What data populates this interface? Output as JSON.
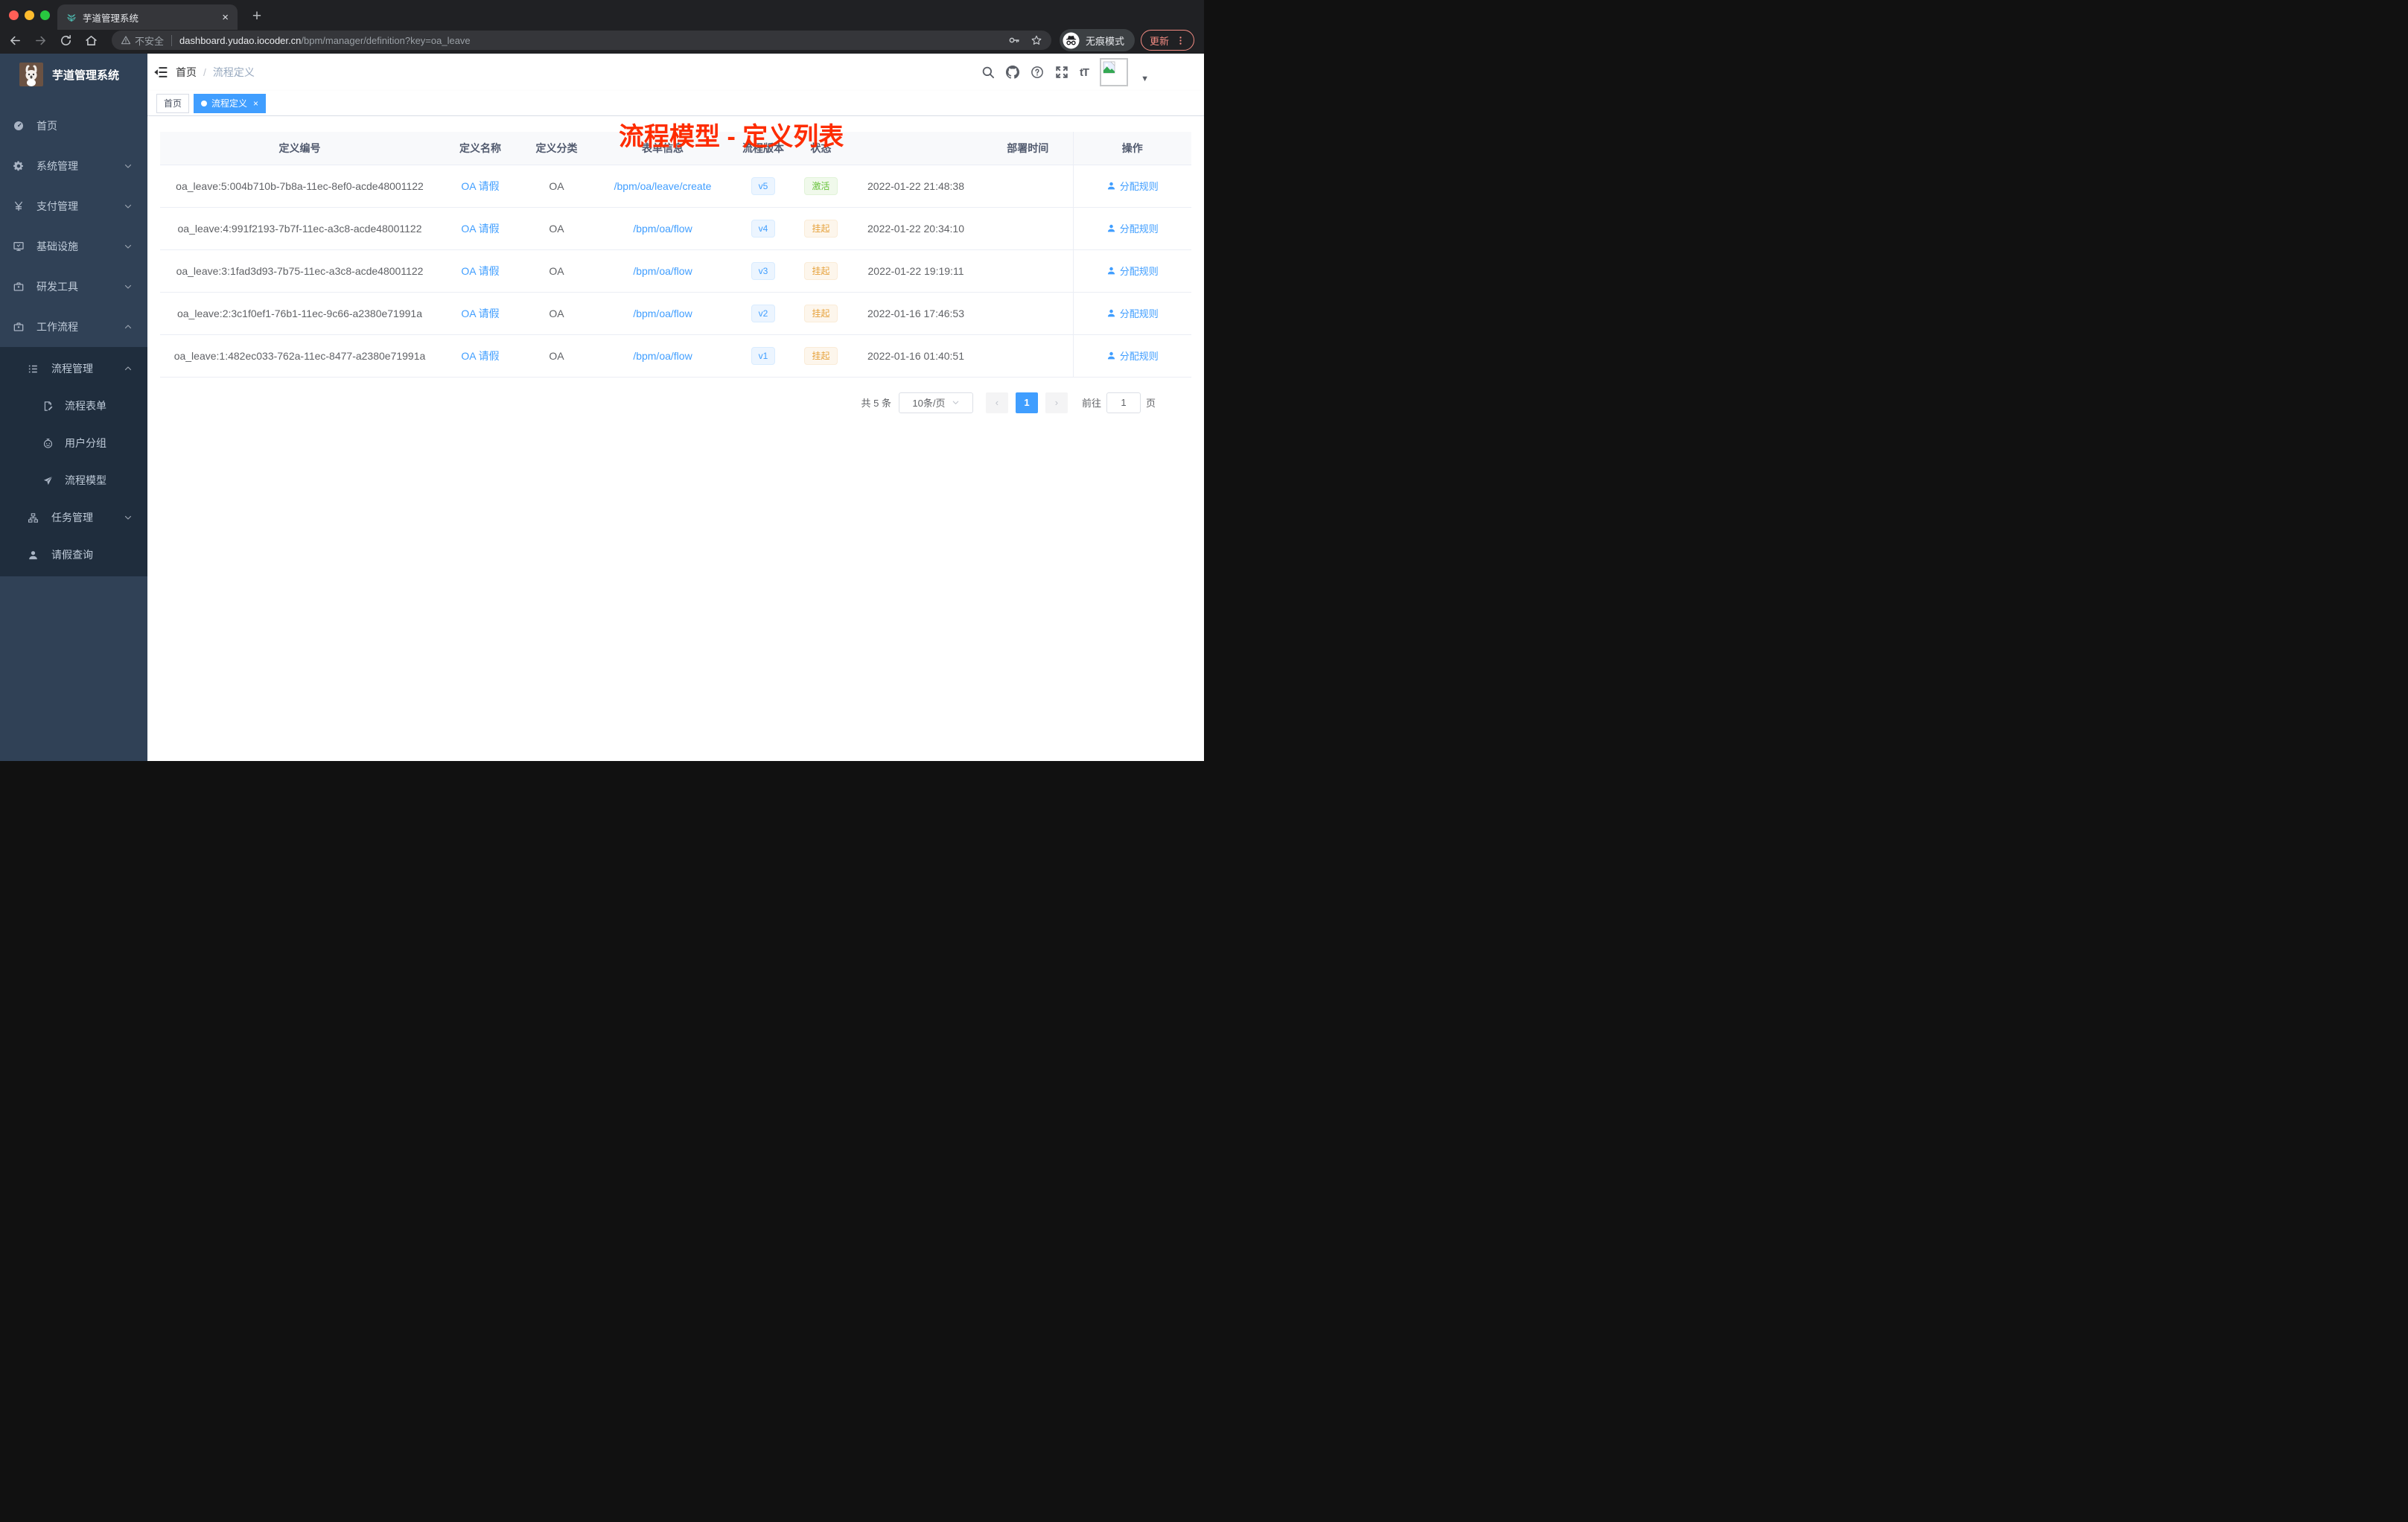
{
  "browser": {
    "tab": {
      "title": "芋道管理系统",
      "close": "×",
      "new_tab": "+"
    },
    "nav": {
      "security_label": "不安全",
      "url_host": "dashboard.yudao.iocoder.cn",
      "url_path": "/bpm/manager/definition?key=oa_leave",
      "incognito_label": "无痕模式",
      "update_label": "更新"
    }
  },
  "sidebar": {
    "app_title": "芋道管理系统",
    "menu": [
      {
        "label": "首页",
        "icon": "dashboard",
        "depth": 0
      },
      {
        "label": "系统管理",
        "icon": "gear",
        "depth": 0,
        "chevron": "down"
      },
      {
        "label": "支付管理",
        "icon": "yen",
        "depth": 0,
        "chevron": "down"
      },
      {
        "label": "基础设施",
        "icon": "monitor",
        "depth": 0,
        "chevron": "down"
      },
      {
        "label": "研发工具",
        "icon": "toolbox",
        "depth": 0,
        "chevron": "down"
      },
      {
        "label": "工作流程",
        "icon": "toolbox",
        "depth": 0,
        "chevron": "up"
      },
      {
        "label": "流程管理",
        "icon": "list",
        "depth": 1,
        "chevron": "up",
        "sub": true
      },
      {
        "label": "流程表单",
        "icon": "doc-edit",
        "depth": 2,
        "sub": true
      },
      {
        "label": "用户分组",
        "icon": "robot",
        "depth": 2,
        "sub": true
      },
      {
        "label": "流程模型",
        "icon": "plane",
        "depth": 2,
        "sub": true
      },
      {
        "label": "任务管理",
        "icon": "tree",
        "depth": 1,
        "chevron": "down",
        "sub": true
      },
      {
        "label": "请假查询",
        "icon": "user",
        "depth": 1,
        "sub": true
      }
    ]
  },
  "navbar": {
    "breadcrumb_home": "首页",
    "breadcrumb_sep": "/",
    "breadcrumb_current": "流程定义"
  },
  "annotation": {
    "text": "流程模型 - 定义列表",
    "color": "#fe2c00"
  },
  "tags_view": [
    {
      "label": "首页",
      "active": false
    },
    {
      "label": "流程定义",
      "active": true,
      "closable": true
    }
  ],
  "table": {
    "columns": [
      "定义编号",
      "定义名称",
      "定义分类",
      "表单信息",
      "流程版本",
      "状态",
      "",
      "部署时间",
      "操作"
    ],
    "rows": [
      {
        "id": "oa_leave:5:004b710b-7b8a-11ec-8ef0-acde48001122",
        "name": "OA 请假",
        "category": "OA",
        "form": "/bpm/oa/leave/create",
        "version": "v5",
        "status": "激活",
        "status_type": "success",
        "deploy_time": "2022-01-22 21:48:38",
        "action": "分配规则"
      },
      {
        "id": "oa_leave:4:991f2193-7b7f-11ec-a3c8-acde48001122",
        "name": "OA 请假",
        "category": "OA",
        "form": "/bpm/oa/flow",
        "version": "v4",
        "status": "挂起",
        "status_type": "warning",
        "deploy_time": "2022-01-22 20:34:10",
        "action": "分配规则"
      },
      {
        "id": "oa_leave:3:1fad3d93-7b75-11ec-a3c8-acde48001122",
        "name": "OA 请假",
        "category": "OA",
        "form": "/bpm/oa/flow",
        "version": "v3",
        "status": "挂起",
        "status_type": "warning",
        "deploy_time": "2022-01-22 19:19:11",
        "action": "分配规则"
      },
      {
        "id": "oa_leave:2:3c1f0ef1-76b1-11ec-9c66-a2380e71991a",
        "name": "OA 请假",
        "category": "OA",
        "form": "/bpm/oa/flow",
        "version": "v2",
        "status": "挂起",
        "status_type": "warning",
        "deploy_time": "2022-01-16 17:46:53",
        "action": "分配规则"
      },
      {
        "id": "oa_leave:1:482ec033-762a-11ec-8477-a2380e71991a",
        "name": "OA 请假",
        "category": "OA",
        "form": "/bpm/oa/flow",
        "version": "v1",
        "status": "挂起",
        "status_type": "warning",
        "deploy_time": "2022-01-16 01:40:51",
        "action": "分配规则"
      }
    ]
  },
  "pagination": {
    "total": "共 5 条",
    "page_size": "10条/页",
    "prev": "‹",
    "page": "1",
    "next": "›",
    "goto_label": "前往",
    "goto_value": "1",
    "page_unit": "页"
  }
}
